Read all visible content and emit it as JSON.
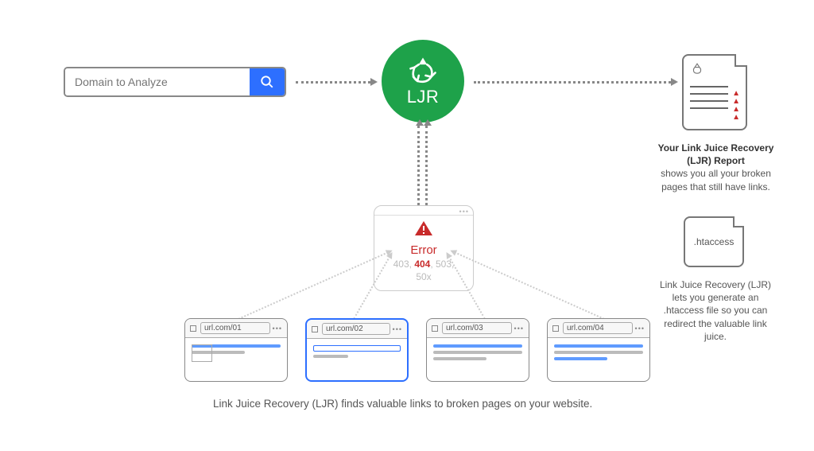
{
  "search": {
    "placeholder": "Domain to Analyze"
  },
  "ljr": {
    "label": "LJR"
  },
  "error": {
    "title": "Error",
    "codes_before": "403, ",
    "code_hot": "404",
    "codes_after": ", 503,",
    "codes_line2": "50x"
  },
  "urls": {
    "u1": "url.com/01",
    "u2": "url.com/02",
    "u3": "url.com/03",
    "u4": "url.com/04"
  },
  "caption": "Link Juice Recovery (LJR) finds valuable links to broken pages on your website.",
  "report": {
    "title_line1": "Your Link Juice Recovery",
    "title_line2": "(LJR) Report",
    "desc": "shows you all your broken pages that still have links."
  },
  "htaccess": {
    "filename": ".htaccess",
    "desc": "Link Juice Recovery (LJR) lets you generate an .htaccess file so you can redirect the valuable link juice."
  }
}
